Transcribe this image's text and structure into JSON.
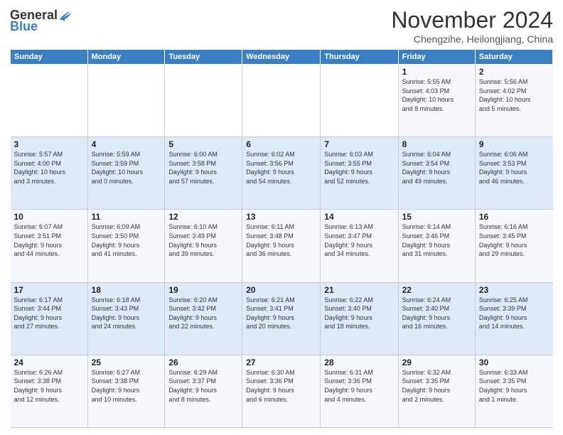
{
  "logo": {
    "text_general": "General",
    "text_blue": "Blue"
  },
  "title": "November 2024",
  "location": "Chengzihe, Heilongjiang, China",
  "header_days": [
    "Sunday",
    "Monday",
    "Tuesday",
    "Wednesday",
    "Thursday",
    "Friday",
    "Saturday"
  ],
  "weeks": [
    [
      {
        "day": "",
        "info": ""
      },
      {
        "day": "",
        "info": ""
      },
      {
        "day": "",
        "info": ""
      },
      {
        "day": "",
        "info": ""
      },
      {
        "day": "",
        "info": ""
      },
      {
        "day": "1",
        "info": "Sunrise: 5:55 AM\nSunset: 4:03 PM\nDaylight: 10 hours\nand 8 minutes."
      },
      {
        "day": "2",
        "info": "Sunrise: 5:56 AM\nSunset: 4:02 PM\nDaylight: 10 hours\nand 5 minutes."
      }
    ],
    [
      {
        "day": "3",
        "info": "Sunrise: 5:57 AM\nSunset: 4:00 PM\nDaylight: 10 hours\nand 3 minutes."
      },
      {
        "day": "4",
        "info": "Sunrise: 5:59 AM\nSunset: 3:59 PM\nDaylight: 10 hours\nand 0 minutes."
      },
      {
        "day": "5",
        "info": "Sunrise: 6:00 AM\nSunset: 3:58 PM\nDaylight: 9 hours\nand 57 minutes."
      },
      {
        "day": "6",
        "info": "Sunrise: 6:02 AM\nSunset: 3:56 PM\nDaylight: 9 hours\nand 54 minutes."
      },
      {
        "day": "7",
        "info": "Sunrise: 6:03 AM\nSunset: 3:55 PM\nDaylight: 9 hours\nand 52 minutes."
      },
      {
        "day": "8",
        "info": "Sunrise: 6:04 AM\nSunset: 3:54 PM\nDaylight: 9 hours\nand 49 minutes."
      },
      {
        "day": "9",
        "info": "Sunrise: 6:06 AM\nSunset: 3:53 PM\nDaylight: 9 hours\nand 46 minutes."
      }
    ],
    [
      {
        "day": "10",
        "info": "Sunrise: 6:07 AM\nSunset: 3:51 PM\nDaylight: 9 hours\nand 44 minutes."
      },
      {
        "day": "11",
        "info": "Sunrise: 6:09 AM\nSunset: 3:50 PM\nDaylight: 9 hours\nand 41 minutes."
      },
      {
        "day": "12",
        "info": "Sunrise: 6:10 AM\nSunset: 3:49 PM\nDaylight: 9 hours\nand 39 minutes."
      },
      {
        "day": "13",
        "info": "Sunrise: 6:11 AM\nSunset: 3:48 PM\nDaylight: 9 hours\nand 36 minutes."
      },
      {
        "day": "14",
        "info": "Sunrise: 6:13 AM\nSunset: 3:47 PM\nDaylight: 9 hours\nand 34 minutes."
      },
      {
        "day": "15",
        "info": "Sunrise: 6:14 AM\nSunset: 3:46 PM\nDaylight: 9 hours\nand 31 minutes."
      },
      {
        "day": "16",
        "info": "Sunrise: 6:16 AM\nSunset: 3:45 PM\nDaylight: 9 hours\nand 29 minutes."
      }
    ],
    [
      {
        "day": "17",
        "info": "Sunrise: 6:17 AM\nSunset: 3:44 PM\nDaylight: 9 hours\nand 27 minutes."
      },
      {
        "day": "18",
        "info": "Sunrise: 6:18 AM\nSunset: 3:43 PM\nDaylight: 9 hours\nand 24 minutes."
      },
      {
        "day": "19",
        "info": "Sunrise: 6:20 AM\nSunset: 3:42 PM\nDaylight: 9 hours\nand 22 minutes."
      },
      {
        "day": "20",
        "info": "Sunrise: 6:21 AM\nSunset: 3:41 PM\nDaylight: 9 hours\nand 20 minutes."
      },
      {
        "day": "21",
        "info": "Sunrise: 6:22 AM\nSunset: 3:40 PM\nDaylight: 9 hours\nand 18 minutes."
      },
      {
        "day": "22",
        "info": "Sunrise: 6:24 AM\nSunset: 3:40 PM\nDaylight: 9 hours\nand 16 minutes."
      },
      {
        "day": "23",
        "info": "Sunrise: 6:25 AM\nSunset: 3:39 PM\nDaylight: 9 hours\nand 14 minutes."
      }
    ],
    [
      {
        "day": "24",
        "info": "Sunrise: 6:26 AM\nSunset: 3:38 PM\nDaylight: 9 hours\nand 12 minutes."
      },
      {
        "day": "25",
        "info": "Sunrise: 6:27 AM\nSunset: 3:38 PM\nDaylight: 9 hours\nand 10 minutes."
      },
      {
        "day": "26",
        "info": "Sunrise: 6:29 AM\nSunset: 3:37 PM\nDaylight: 9 hours\nand 8 minutes."
      },
      {
        "day": "27",
        "info": "Sunrise: 6:30 AM\nSunset: 3:36 PM\nDaylight: 9 hours\nand 6 minutes."
      },
      {
        "day": "28",
        "info": "Sunrise: 6:31 AM\nSunset: 3:36 PM\nDaylight: 9 hours\nand 4 minutes."
      },
      {
        "day": "29",
        "info": "Sunrise: 6:32 AM\nSunset: 3:35 PM\nDaylight: 9 hours\nand 2 minutes."
      },
      {
        "day": "30",
        "info": "Sunrise: 6:33 AM\nSunset: 3:35 PM\nDaylight: 9 hours\nand 1 minute."
      }
    ]
  ]
}
